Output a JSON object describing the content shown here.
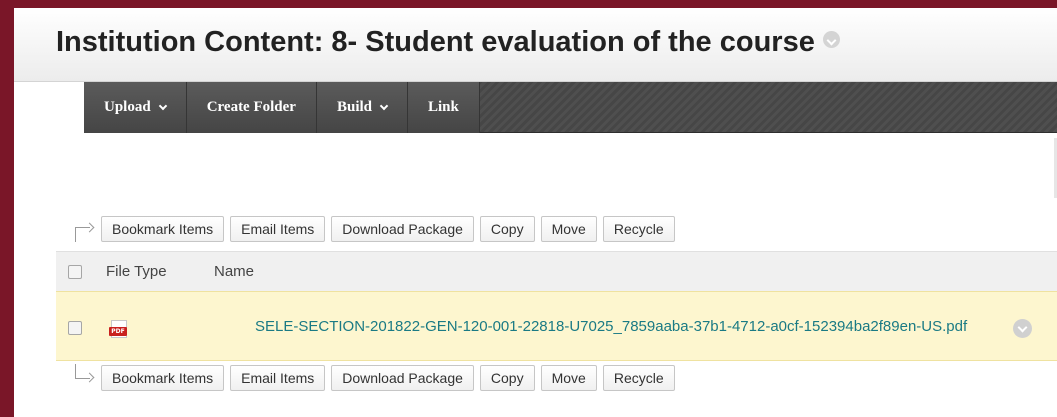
{
  "page": {
    "title": "Institution Content: 8- Student evaluation of the course"
  },
  "action_bar": {
    "tabs": [
      {
        "label": "Upload",
        "has_menu": true
      },
      {
        "label": "Create Folder",
        "has_menu": false
      },
      {
        "label": "Build",
        "has_menu": true
      },
      {
        "label": "Link",
        "has_menu": false
      }
    ]
  },
  "toolbar": {
    "buttons": [
      "Bookmark Items",
      "Email Items",
      "Download Package",
      "Copy",
      "Move",
      "Recycle"
    ]
  },
  "list": {
    "columns": [
      "File Type",
      "Name"
    ],
    "rows": [
      {
        "file_type_icon": "pdf-icon",
        "file_type_label": "PDF",
        "name": "SELE-SECTION-201822-GEN-120-001-22818-U7025_7859aaba-37b1-4712-a0cf-152394ba2f89en-US.pdf",
        "selected": false
      }
    ]
  },
  "colors": {
    "frame_background": "#7a1628",
    "action_bar": "#4a4a4a",
    "row_highlight": "#fdf6cf",
    "link": "#1a7a84"
  }
}
